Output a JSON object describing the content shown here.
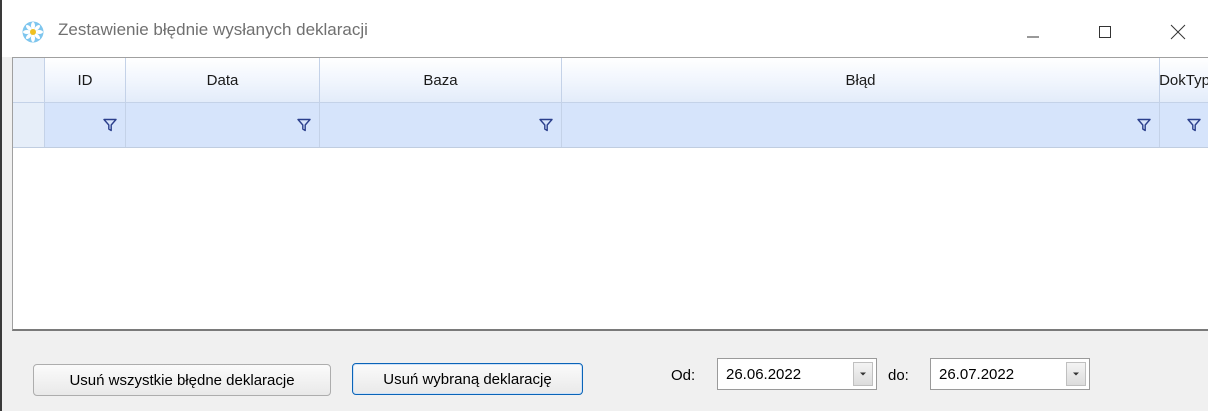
{
  "window": {
    "title": "Zestawienie błędnie wysłanych deklaracji",
    "icon": "app-flower-icon"
  },
  "grid": {
    "columns": [
      "ID",
      "Data",
      "Baza",
      "Błąd",
      "DokTyp"
    ],
    "filter_icon": "filter-funnel-icon",
    "rows": []
  },
  "footer": {
    "delete_all_label": "Usuń wszystkie błędne deklaracje",
    "delete_selected_label": "Usuń wybraną deklarację",
    "from_label": "Od:",
    "from_value": "26.06.2022",
    "to_label": "do:",
    "to_value": "26.07.2022"
  },
  "colors": {
    "header_gradient_bottom": "#e3ecfa",
    "filter_row": "#d6e4fb",
    "focused_button_border": "#0a64b8"
  }
}
